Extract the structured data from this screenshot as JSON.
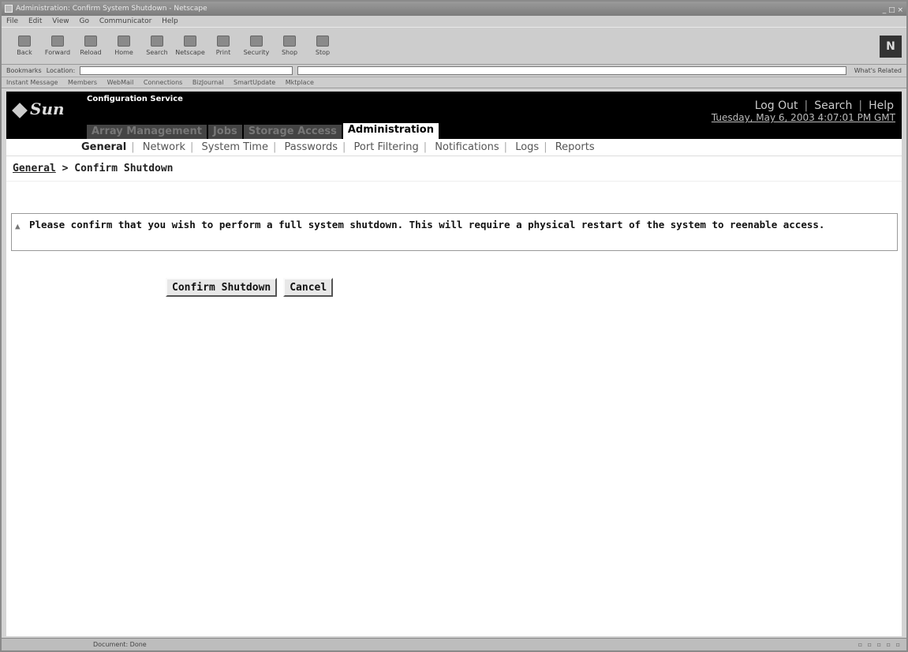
{
  "browser": {
    "title": "Administration: Confirm System Shutdown - Netscape",
    "window_controls": "_ □ ×",
    "menu": [
      "File",
      "Edit",
      "View",
      "Go",
      "Communicator",
      "Help"
    ],
    "toolbar": [
      "Back",
      "Forward",
      "Reload",
      "Home",
      "Search",
      "Netscape",
      "Print",
      "Security",
      "Shop",
      "Stop"
    ],
    "bookmarks_label": "Bookmarks",
    "location_label": "Location:",
    "location_value": "",
    "related_label": "What's Related",
    "personal_toolbar": [
      "Instant Message",
      "Members",
      "WebMail",
      "Connections",
      "BizJournal",
      "SmartUpdate",
      "Mktplace"
    ],
    "status_text": "Document: Done",
    "logo": "N"
  },
  "app": {
    "brand": "Sun",
    "name": "Configuration Service",
    "top_links": [
      "Log Out",
      "Search",
      "Help"
    ],
    "datetime": "Tuesday, May 6, 2003 4:07:01 PM GMT",
    "tabs": [
      {
        "label": "Array Management",
        "active": false
      },
      {
        "label": "Jobs",
        "active": false
      },
      {
        "label": "Storage Access",
        "active": false
      },
      {
        "label": "Administration",
        "active": true
      }
    ],
    "subnav": [
      {
        "label": "General",
        "active": true
      },
      {
        "label": "Network",
        "active": false
      },
      {
        "label": "System Time",
        "active": false
      },
      {
        "label": "Passwords",
        "active": false
      },
      {
        "label": "Port Filtering",
        "active": false
      },
      {
        "label": "Notifications",
        "active": false
      },
      {
        "label": "Logs",
        "active": false
      },
      {
        "label": "Reports",
        "active": false
      }
    ],
    "breadcrumb": {
      "parent": "General",
      "separator": " > ",
      "current": "Confirm Shutdown"
    },
    "alert_message": "Please confirm that you wish to perform a full system shutdown. This will require a physical restart of the system to reenable access.",
    "buttons": {
      "confirm": "Confirm Shutdown",
      "cancel": "Cancel"
    }
  }
}
